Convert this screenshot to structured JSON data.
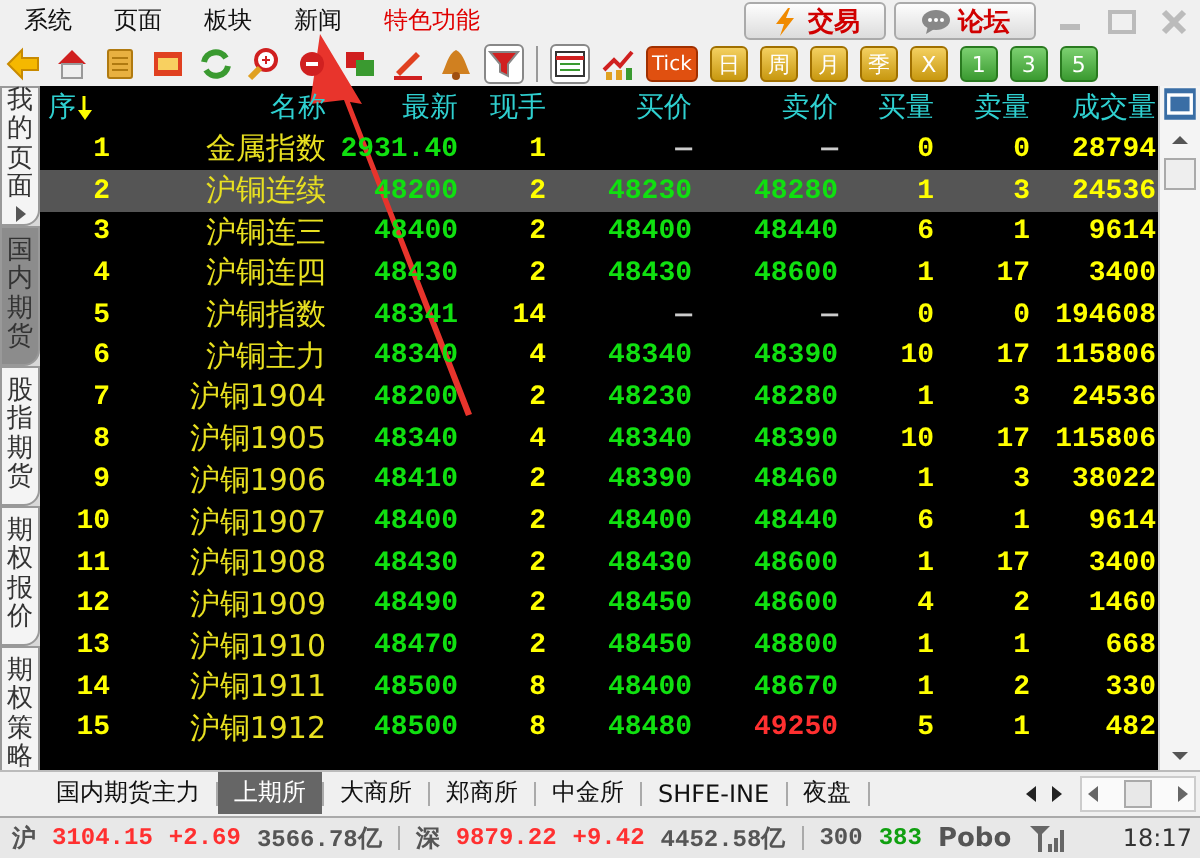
{
  "menu": [
    {
      "label": "系统",
      "kind": "plain"
    },
    {
      "label": "页面",
      "kind": "plain"
    },
    {
      "label": "板块",
      "kind": "plain"
    },
    {
      "label": "新闻",
      "kind": "plain"
    },
    {
      "label": "特色功能",
      "kind": "highlight"
    }
  ],
  "actions": [
    {
      "label": "交易",
      "kind": "trade"
    },
    {
      "label": "论坛",
      "kind": "forum"
    }
  ],
  "toolbar": {
    "tick": "Tick",
    "periods": [
      "日",
      "周",
      "月",
      "季",
      "X"
    ],
    "counts": [
      "1",
      "3",
      "5"
    ]
  },
  "side_tabs": [
    {
      "label": "我的页面",
      "selected": false
    },
    {
      "label": "国内期货",
      "selected": true
    },
    {
      "label": "股指期货",
      "selected": false
    },
    {
      "label": "期权报价",
      "selected": false
    },
    {
      "label": "期权策略",
      "selected": false
    }
  ],
  "table": {
    "columns": [
      "序",
      "名称",
      "最新",
      "现手",
      "买价",
      "卖价",
      "买量",
      "卖量",
      "成交量"
    ],
    "rows": [
      {
        "no": "1",
        "name": "金属指数",
        "latest": {
          "value": "2931.40",
          "color": "#10e010"
        },
        "hand": "1",
        "bid": {
          "value": "—",
          "color": "#cccccc"
        },
        "ask": {
          "value": "—",
          "color": "#cccccc"
        },
        "bid_qty": "0",
        "ask_qty": "0",
        "volume": "28794",
        "selected": false
      },
      {
        "no": "2",
        "name": "沪铜连续",
        "latest": {
          "value": "48200",
          "color": "#10e010"
        },
        "hand": "2",
        "bid": {
          "value": "48230",
          "color": "#10e010"
        },
        "ask": {
          "value": "48280",
          "color": "#10e010"
        },
        "bid_qty": "1",
        "ask_qty": "3",
        "volume": "24536",
        "selected": true
      },
      {
        "no": "3",
        "name": "沪铜连三",
        "latest": {
          "value": "48400",
          "color": "#10e010"
        },
        "hand": "2",
        "bid": {
          "value": "48400",
          "color": "#10e010"
        },
        "ask": {
          "value": "48440",
          "color": "#10e010"
        },
        "bid_qty": "6",
        "ask_qty": "1",
        "volume": "9614",
        "selected": false
      },
      {
        "no": "4",
        "name": "沪铜连四",
        "latest": {
          "value": "48430",
          "color": "#10e010"
        },
        "hand": "2",
        "bid": {
          "value": "48430",
          "color": "#10e010"
        },
        "ask": {
          "value": "48600",
          "color": "#10e010"
        },
        "bid_qty": "1",
        "ask_qty": "17",
        "volume": "3400",
        "selected": false
      },
      {
        "no": "5",
        "name": "沪铜指数",
        "latest": {
          "value": "48341",
          "color": "#10e010"
        },
        "hand": "14",
        "bid": {
          "value": "—",
          "color": "#cccccc"
        },
        "ask": {
          "value": "—",
          "color": "#cccccc"
        },
        "bid_qty": "0",
        "ask_qty": "0",
        "volume": "194608",
        "selected": false
      },
      {
        "no": "6",
        "name": "沪铜主力",
        "latest": {
          "value": "48340",
          "color": "#10e010"
        },
        "hand": "4",
        "bid": {
          "value": "48340",
          "color": "#10e010"
        },
        "ask": {
          "value": "48390",
          "color": "#10e010"
        },
        "bid_qty": "10",
        "ask_qty": "17",
        "volume": "115806",
        "selected": false
      },
      {
        "no": "7",
        "name": "沪铜1904",
        "latest": {
          "value": "48200",
          "color": "#10e010"
        },
        "hand": "2",
        "bid": {
          "value": "48230",
          "color": "#10e010"
        },
        "ask": {
          "value": "48280",
          "color": "#10e010"
        },
        "bid_qty": "1",
        "ask_qty": "3",
        "volume": "24536",
        "selected": false
      },
      {
        "no": "8",
        "name": "沪铜1905",
        "latest": {
          "value": "48340",
          "color": "#10e010"
        },
        "hand": "4",
        "bid": {
          "value": "48340",
          "color": "#10e010"
        },
        "ask": {
          "value": "48390",
          "color": "#10e010"
        },
        "bid_qty": "10",
        "ask_qty": "17",
        "volume": "115806",
        "selected": false
      },
      {
        "no": "9",
        "name": "沪铜1906",
        "latest": {
          "value": "48410",
          "color": "#10e010"
        },
        "hand": "2",
        "bid": {
          "value": "48390",
          "color": "#10e010"
        },
        "ask": {
          "value": "48460",
          "color": "#10e010"
        },
        "bid_qty": "1",
        "ask_qty": "3",
        "volume": "38022",
        "selected": false
      },
      {
        "no": "10",
        "name": "沪铜1907",
        "latest": {
          "value": "48400",
          "color": "#10e010"
        },
        "hand": "2",
        "bid": {
          "value": "48400",
          "color": "#10e010"
        },
        "ask": {
          "value": "48440",
          "color": "#10e010"
        },
        "bid_qty": "6",
        "ask_qty": "1",
        "volume": "9614",
        "selected": false
      },
      {
        "no": "11",
        "name": "沪铜1908",
        "latest": {
          "value": "48430",
          "color": "#10e010"
        },
        "hand": "2",
        "bid": {
          "value": "48430",
          "color": "#10e010"
        },
        "ask": {
          "value": "48600",
          "color": "#10e010"
        },
        "bid_qty": "1",
        "ask_qty": "17",
        "volume": "3400",
        "selected": false
      },
      {
        "no": "12",
        "name": "沪铜1909",
        "latest": {
          "value": "48490",
          "color": "#10e010"
        },
        "hand": "2",
        "bid": {
          "value": "48450",
          "color": "#10e010"
        },
        "ask": {
          "value": "48600",
          "color": "#10e010"
        },
        "bid_qty": "4",
        "ask_qty": "2",
        "volume": "1460",
        "selected": false
      },
      {
        "no": "13",
        "name": "沪铜1910",
        "latest": {
          "value": "48470",
          "color": "#10e010"
        },
        "hand": "2",
        "bid": {
          "value": "48450",
          "color": "#10e010"
        },
        "ask": {
          "value": "48800",
          "color": "#10e010"
        },
        "bid_qty": "1",
        "ask_qty": "1",
        "volume": "668",
        "selected": false
      },
      {
        "no": "14",
        "name": "沪铜1911",
        "latest": {
          "value": "48500",
          "color": "#10e010"
        },
        "hand": "8",
        "bid": {
          "value": "48400",
          "color": "#10e010"
        },
        "ask": {
          "value": "48670",
          "color": "#10e010"
        },
        "bid_qty": "1",
        "ask_qty": "2",
        "volume": "330",
        "selected": false
      },
      {
        "no": "15",
        "name": "沪铜1912",
        "latest": {
          "value": "48500",
          "color": "#10e010"
        },
        "hand": "8",
        "bid": {
          "value": "48480",
          "color": "#10e010"
        },
        "ask": {
          "value": "49250",
          "color": "#ff3030"
        },
        "bid_qty": "5",
        "ask_qty": "1",
        "volume": "482",
        "selected": false
      }
    ]
  },
  "market_tabs": [
    {
      "label": "国内期货主力",
      "selected": false
    },
    {
      "label": "上期所",
      "selected": true
    },
    {
      "label": "大商所",
      "selected": false
    },
    {
      "label": "郑商所",
      "selected": false
    },
    {
      "label": "中金所",
      "selected": false
    },
    {
      "label": "SHFE-INE",
      "selected": false
    },
    {
      "label": "夜盘",
      "selected": false
    }
  ],
  "status": [
    {
      "text": "沪",
      "kind": "label"
    },
    {
      "text": "3104.15",
      "kind": "up"
    },
    {
      "text": "+2.69",
      "kind": "up"
    },
    {
      "text": "3566.78亿",
      "kind": "plain"
    },
    {
      "text": "深",
      "kind": "label"
    },
    {
      "text": "9879.22",
      "kind": "up"
    },
    {
      "text": "+9.42",
      "kind": "up"
    },
    {
      "text": "4452.58亿",
      "kind": "plain"
    },
    {
      "text": "300",
      "kind": "label"
    },
    {
      "text": "383",
      "kind": "down"
    }
  ],
  "brand": "Pobo",
  "time": "18:17"
}
